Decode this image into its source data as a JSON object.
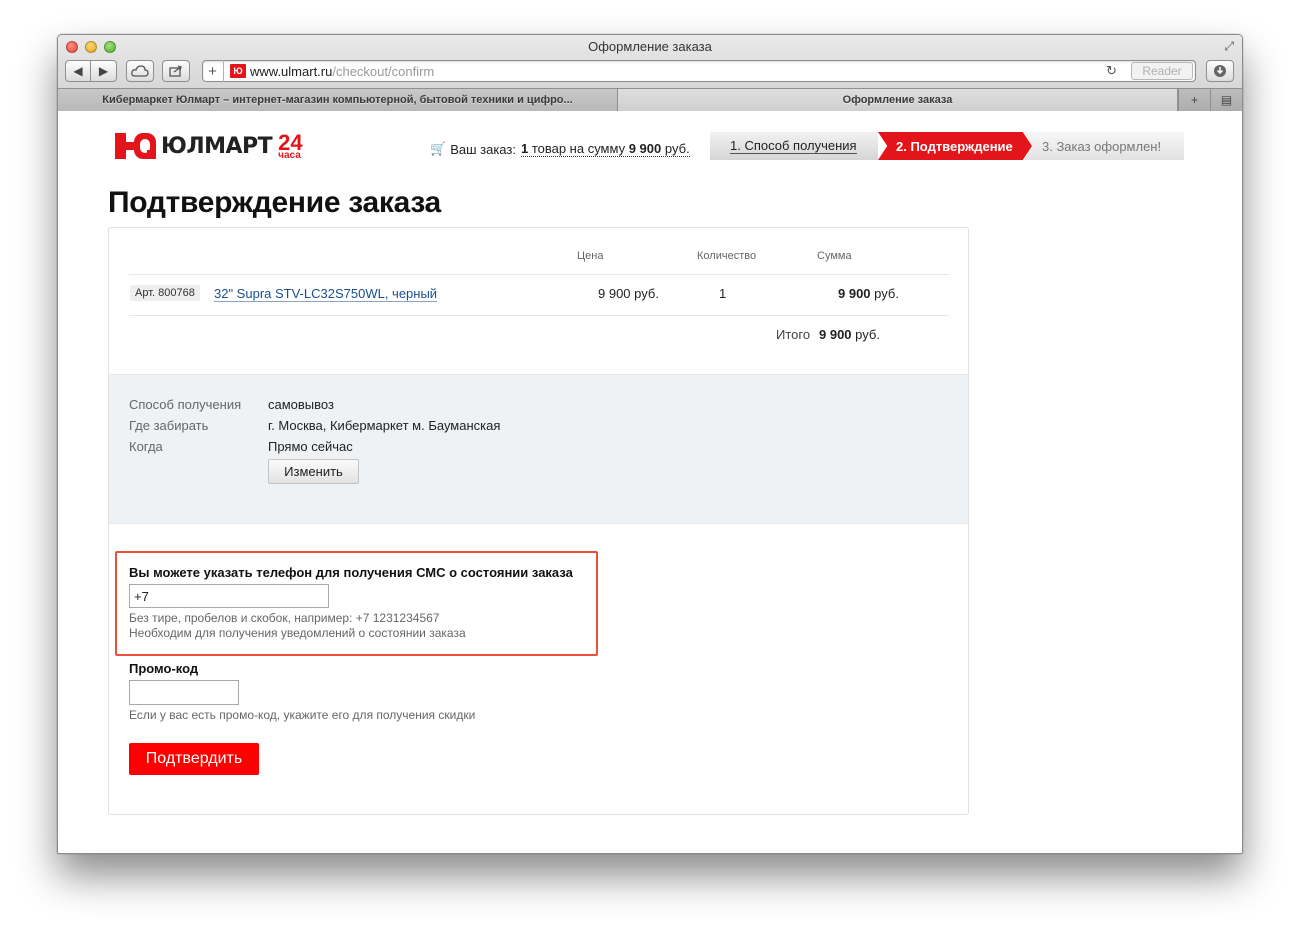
{
  "window": {
    "title": "Оформление заказа",
    "url_host": "www.ulmart.ru",
    "url_path": "/checkout/confirm",
    "reader_label": "Reader",
    "tabs": [
      {
        "label": "Кибермаркет Юлмарт – интернет-магазин компьютерной, бытовой техники и цифро..."
      },
      {
        "label": "Оформление заказа"
      }
    ]
  },
  "header": {
    "logo_text": "ЮЛМАРТ",
    "logo_24": "24",
    "logo_hours": "часа",
    "order_prefix": "Ваш заказ:",
    "order_count": "1",
    "order_middle": "товар на сумму",
    "order_sum": "9 900",
    "order_currency": "руб.",
    "steps": [
      {
        "label": "1. Способ получения"
      },
      {
        "label": "2. Подтверждение"
      },
      {
        "label": "3. Заказ оформлен!"
      }
    ]
  },
  "page_title": "Подтверждение заказа",
  "table": {
    "headers": {
      "price": "Цена",
      "quantity": "Количество",
      "sum": "Сумма"
    },
    "rows": [
      {
        "article": "Арт. 800768",
        "name": "32\" Supra STV-LC32S750WL, черный",
        "price": "9 900 руб.",
        "quantity": "1",
        "sum_value": "9 900",
        "sum_currency": "руб."
      }
    ],
    "total_label": "Итого",
    "total_value": "9 900",
    "total_currency": "руб."
  },
  "delivery": {
    "method_label": "Способ получения",
    "method_value": "самовывоз",
    "place_label": "Где забирать",
    "place_value": "г. Москва, Кибермаркет м. Бауманская",
    "when_label": "Когда",
    "when_value": "Прямо сейчас",
    "change_button": "Изменить"
  },
  "sms": {
    "title": "Вы можете указать телефон для получения СМС о состоянии заказа",
    "phone_value": "+7",
    "hint_1": "Без тире, пробелов и скобок, например: +7 1231234567",
    "hint_2": "Необходим для получения уведомлений о состоянии заказа"
  },
  "promo": {
    "title": "Промо-код",
    "value": "",
    "hint": "Если у вас есть промо-код, укажите его для получения скидки"
  },
  "confirm_button": "Подтвердить",
  "colors": {
    "brand_red": "#e4141b",
    "link_blue": "#1a4f8f",
    "highlight_border": "#e8513a"
  }
}
